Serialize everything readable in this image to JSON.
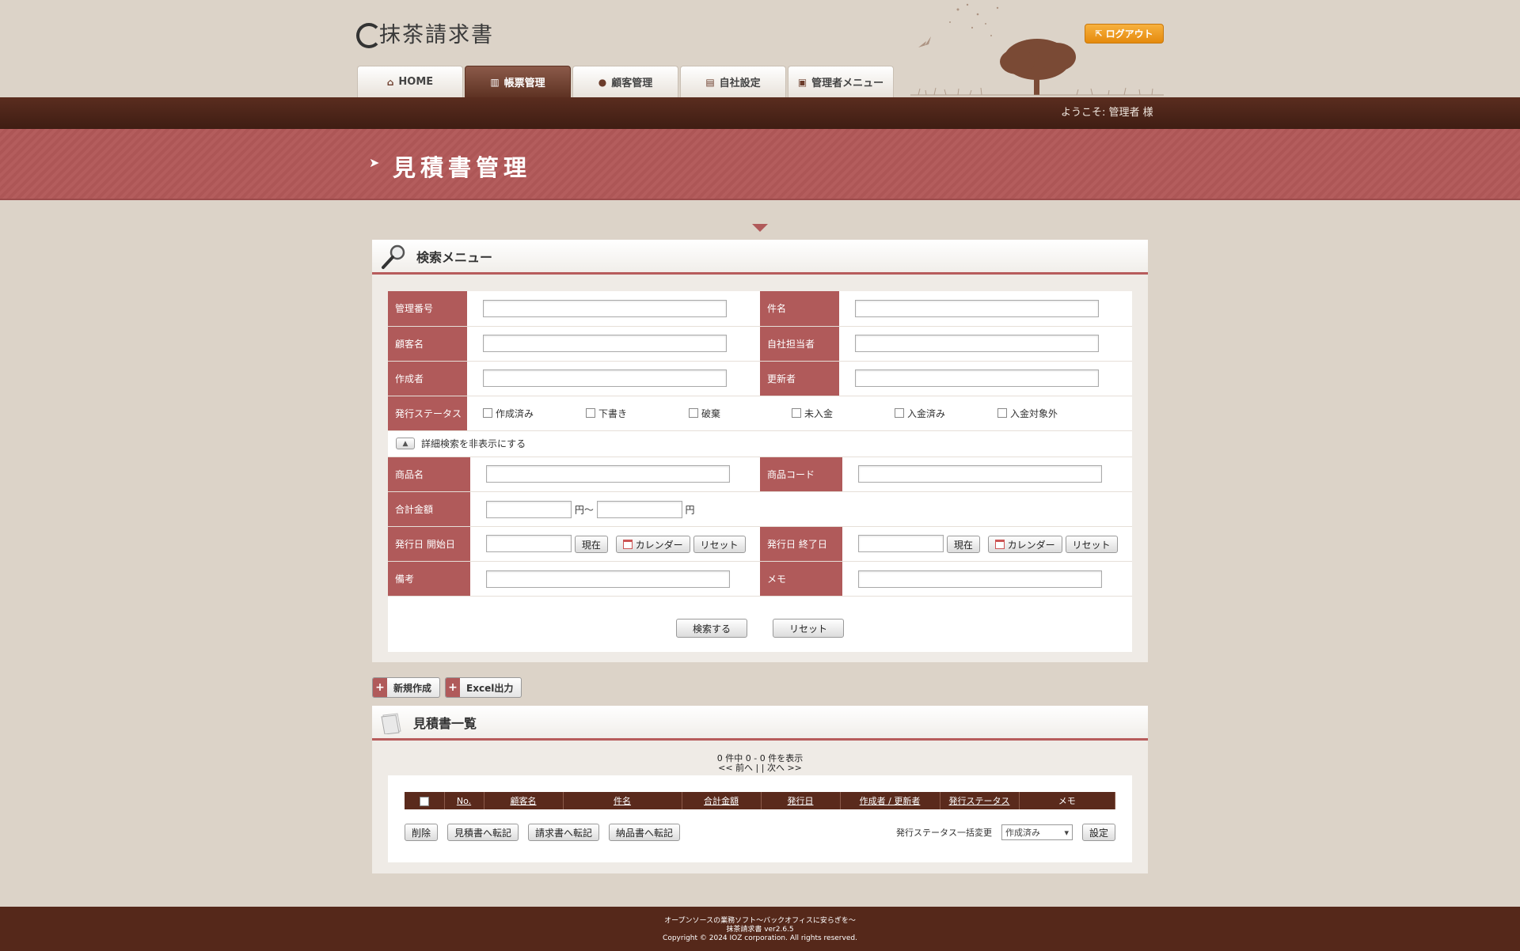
{
  "header": {
    "logo_text": "抹茶請求書",
    "logout_label": "ログアウト",
    "welcome": "ようこそ: 管理者 様",
    "tabs": [
      {
        "label": "HOME",
        "icon": "home-icon"
      },
      {
        "label": "帳票管理",
        "icon": "book-icon"
      },
      {
        "label": "顧客管理",
        "icon": "person-icon"
      },
      {
        "label": "自社設定",
        "icon": "building-icon"
      },
      {
        "label": "管理者メニュー",
        "icon": "lock-icon"
      }
    ],
    "active_tab": 1
  },
  "page_title": "見積書管理",
  "search": {
    "heading": "検索メニュー",
    "fields": {
      "manage_no": "管理番号",
      "subject": "件名",
      "customer": "顧客名",
      "staff": "自社担当者",
      "creator": "作成者",
      "updater": "更新者",
      "status": "発行ステータス",
      "product_name": "商品名",
      "product_code": "商品コード",
      "total": "合計金額",
      "issue_start": "発行日 開始日",
      "issue_end": "発行日 終了日",
      "note": "備考",
      "memo": "メモ"
    },
    "status_options": [
      "作成済み",
      "下書き",
      "破棄",
      "未入金",
      "入金済み",
      "入金対象外"
    ],
    "toggle_label": "詳細検索を非表示にする",
    "yen": "円",
    "range_sep": "円～",
    "now_label": "現在",
    "calendar_label": "カレンダー",
    "reset_label": "リセット",
    "search_button": "検索する",
    "form_reset_button": "リセット"
  },
  "actions": {
    "new_label": "新規作成",
    "excel_label": "Excel出力"
  },
  "list": {
    "heading": "見積書一覧",
    "pager_line1": "0 件中 0 - 0 件を表示",
    "pager_line2": "<< 前へ | | 次へ >>",
    "columns": [
      "No.",
      "顧客名",
      "件名",
      "合計金額",
      "発行日",
      "作成者 / 更新者",
      "発行ステータス",
      "メモ"
    ],
    "delete_label": "削除",
    "to_estimate": "見積書へ転記",
    "to_invoice": "請求書へ転記",
    "to_delivery": "納品書へ転記",
    "bulk_label": "発行ステータス一括変更",
    "bulk_selected": "作成済み",
    "set_label": "設定"
  },
  "footer": {
    "line1": "オープンソースの業務ソフト～バックオフィスに安らぎを～",
    "line2": "抹茶請求書 ver2.6.5",
    "line3": "Copyright © 2024 IOZ corporation. All rights reserved."
  },
  "colors": {
    "accent": "#b05a5a",
    "dark_brown": "#55281a",
    "background": "#dcd3c8",
    "logout_orange": "#f0a030"
  }
}
